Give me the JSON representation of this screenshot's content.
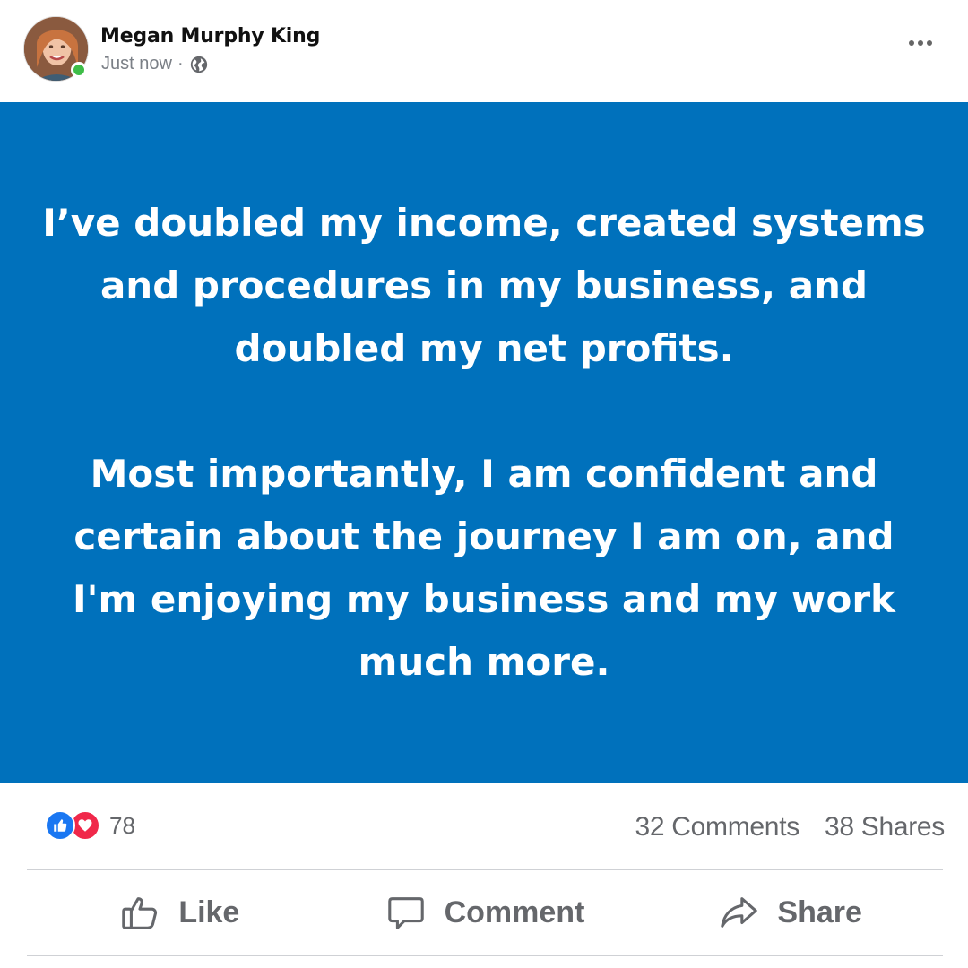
{
  "post": {
    "author": "Megan Murphy King",
    "timestamp": "Just now",
    "separator": "·",
    "privacy_icon": "globe-icon",
    "body": [
      "I’ve doubled my income, created systems and procedures in my business, and doubled my net profits.",
      "Most importantly, I am confident and certain about the journey I am on, and I'm enjoying my business and my work much more."
    ],
    "background_color": "#0071bc"
  },
  "stats": {
    "reactions_count": "78",
    "comments": "32 Comments",
    "shares": "38 Shares"
  },
  "actions": {
    "like": "Like",
    "comment": "Comment",
    "share": "Share"
  }
}
